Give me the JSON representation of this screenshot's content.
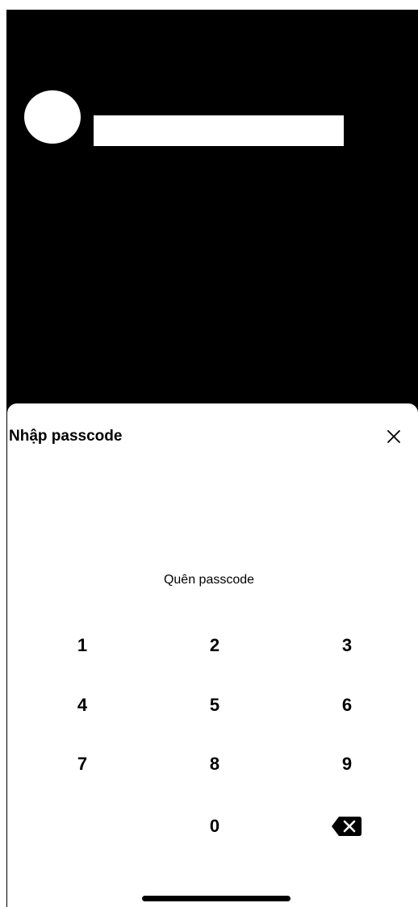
{
  "header": {
    "avatar_icon": "avatar-placeholder",
    "name_redacted": true
  },
  "sheet": {
    "title": "Nhập passcode",
    "close_icon": "close-icon"
  },
  "forgot_passcode": "Quên passcode",
  "keypad": {
    "keys": [
      "1",
      "2",
      "3",
      "4",
      "5",
      "6",
      "7",
      "8",
      "9",
      "0"
    ],
    "delete_icon": "backspace-icon"
  },
  "colors": {
    "background": "#000000",
    "sheet": "#ffffff",
    "text": "#000000"
  }
}
